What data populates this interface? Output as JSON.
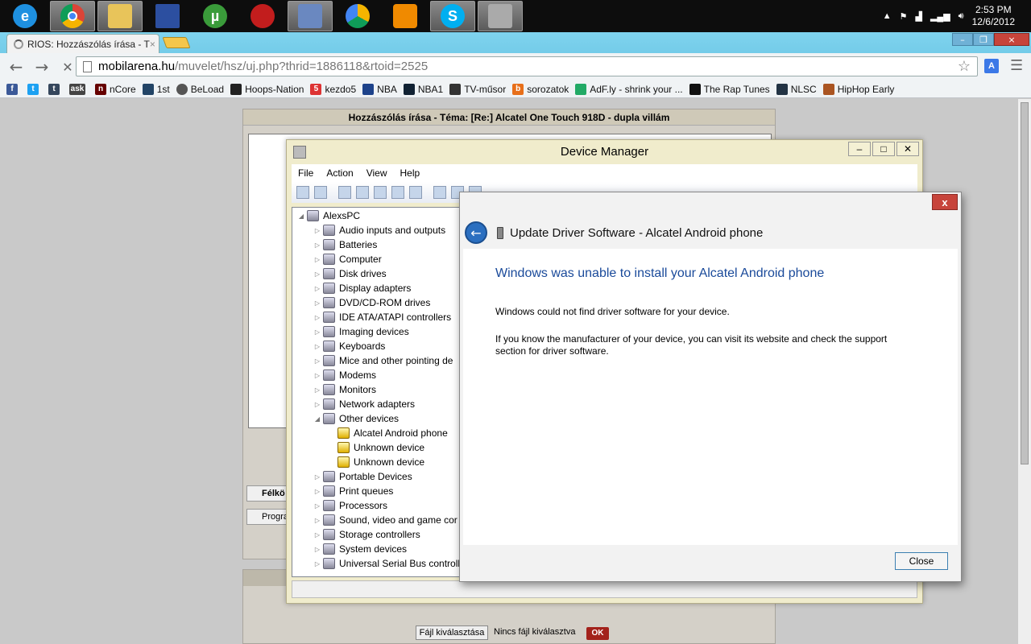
{
  "taskbar": {
    "apps": [
      "ie-icon",
      "chrome-icon",
      "explorer-icon",
      "floppy-icon",
      "utorrent-icon",
      "media-icon",
      "remote-desktop-icon",
      "drive-icon",
      "vlc-icon",
      "skype-icon",
      "device-manager-icon"
    ],
    "time": "2:53 PM",
    "date": "12/6/2012"
  },
  "browser": {
    "tab_title": "RIOS: Hozzászólás írása - T",
    "url_host": "mobilarena.hu",
    "url_path": "/muvelet/hsz/uj.php?thrid=1886118&rtoid=2525",
    "bookmarks": [
      "nCore",
      "1st",
      "BeLoad",
      "Hoops-Nation",
      "kezdo5",
      "NBA",
      "NBA1",
      "TV-műsor",
      "sorozatok",
      "AdF.ly - shrink your ...",
      "The Rap Tunes",
      "NLSC",
      "HipHop Early"
    ]
  },
  "forum": {
    "title": "Hozzászólás írása - Téma: [Re:] Alcatel One Touch 918D - dupla villám",
    "btn1": "Félkö",
    "btn2": "Progra",
    "file_button": "Fájl kiválasztása",
    "file_status": "Nincs fájl kiválasztva",
    "ok": "OK"
  },
  "device_manager": {
    "title": "Device Manager",
    "menu": [
      "File",
      "Action",
      "View",
      "Help"
    ],
    "root": "AlexsPC",
    "categories": [
      "Audio inputs and outputs",
      "Batteries",
      "Computer",
      "Disk drives",
      "Display adapters",
      "DVD/CD-ROM drives",
      "IDE ATA/ATAPI controllers",
      "Imaging devices",
      "Keyboards",
      "Mice and other pointing de",
      "Modems",
      "Monitors",
      "Network adapters",
      "Other devices"
    ],
    "other_devices": [
      "Alcatel Android phone",
      "Unknown device",
      "Unknown device"
    ],
    "categories_after": [
      "Portable Devices",
      "Print queues",
      "Processors",
      "Sound, video and game cor",
      "Storage controllers",
      "System devices",
      "Universal Serial Bus controll"
    ]
  },
  "dialog": {
    "title": "Update Driver Software - Alcatel Android phone",
    "heading": "Windows was unable to install your Alcatel Android phone",
    "message1": "Windows could not find driver software for your device.",
    "message2": "If you know the manufacturer of your device, you can visit its website and check the support section for driver software.",
    "close_label": "Close",
    "close_x": "x"
  },
  "colors": {
    "chrome_frame": "#6cc8e8",
    "dialog_heading": "#1a4a9a",
    "taskbar": "#0d0d0d",
    "close_red": "#c7443b"
  }
}
